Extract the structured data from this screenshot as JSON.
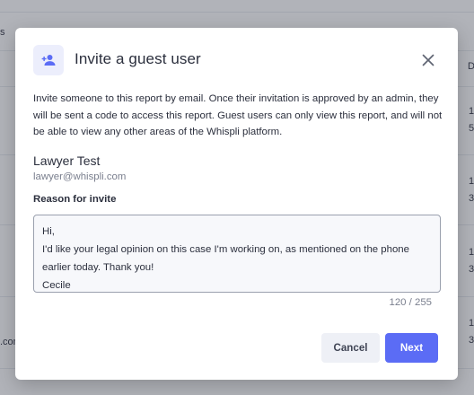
{
  "background": {
    "fragments": [
      "s",
      "D",
      "1",
      "5",
      "1",
      "3",
      "1",
      "3",
      ".com",
      "1",
      "3"
    ]
  },
  "modal": {
    "title": "Invite a guest user",
    "description": "Invite someone to this report by email. Once their invitation is approved by an admin, they will be sent a code to access this report. Guest users can only view this report, and will not be able to view any other areas of the Whispli platform.",
    "guest": {
      "name": "Lawyer Test",
      "email": "lawyer@whispli.com"
    },
    "reason": {
      "label": "Reason for invite",
      "lines": [
        "Hi,",
        "I'd like your legal opinion on this case I'm working on, as mentioned on the phone",
        "earlier today. Thank you!",
        "Cecile"
      ],
      "char_count": "120 / 255"
    },
    "buttons": {
      "cancel": "Cancel",
      "next": "Next"
    }
  },
  "icons": {
    "header": "add-person-icon",
    "close": "close-icon"
  },
  "colors": {
    "accent": "#5b6cf5",
    "icon_bg": "#eceefc"
  }
}
